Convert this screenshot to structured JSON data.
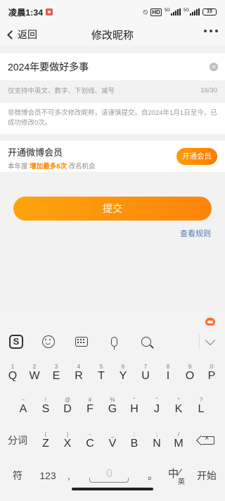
{
  "status_bar": {
    "time": "凌晨1:34",
    "hd_badge": "HD",
    "net1": "5G",
    "net2": "5G",
    "battery": "15"
  },
  "nav": {
    "back_label": "返回",
    "title": "修改昵称"
  },
  "form": {
    "nickname_value": "2024年要做好多事",
    "hint": "仅支持中英文、数字、下划线、减号",
    "char_count": "16/30",
    "notice": "非微博会员不可多次修改昵称，请谨慎提交。自2024年1月1日至今，已成功修改0次。"
  },
  "vip": {
    "title": "开通微博会员",
    "desc_prefix": "本年度",
    "desc_highlight": "增加最多8次",
    "desc_suffix": "改名机会",
    "button_label": "开通会员",
    "accent_color": "#ff8200"
  },
  "actions": {
    "submit_label": "提交",
    "rules_link": "查看规则",
    "submit_color": "#ff8f00",
    "link_color": "#507daf"
  },
  "keyboard": {
    "toolbar_icons": [
      "sogou-logo-icon",
      "emoji-icon",
      "keyboard-icon",
      "microphone-icon",
      "search-icon",
      "chevron-down-icon"
    ],
    "sogou_glyph": "S",
    "row1": [
      {
        "main": "Q",
        "sub": "1"
      },
      {
        "main": "W",
        "sub": "2"
      },
      {
        "main": "E",
        "sub": "3"
      },
      {
        "main": "R",
        "sub": "4"
      },
      {
        "main": "T",
        "sub": "5"
      },
      {
        "main": "Y",
        "sub": "6"
      },
      {
        "main": "U",
        "sub": "7"
      },
      {
        "main": "I",
        "sub": "8"
      },
      {
        "main": "O",
        "sub": "9"
      },
      {
        "main": "P",
        "sub": "0"
      }
    ],
    "row2": [
      {
        "main": "A",
        "sub": "~"
      },
      {
        "main": "S",
        "sub": "!"
      },
      {
        "main": "D",
        "sub": "@"
      },
      {
        "main": "F",
        "sub": "#"
      },
      {
        "main": "G",
        "sub": "%"
      },
      {
        "main": "H",
        "sub": "“"
      },
      {
        "main": "J",
        "sub": "”"
      },
      {
        "main": "K",
        "sub": "*"
      },
      {
        "main": "L",
        "sub": "?"
      }
    ],
    "row3": [
      {
        "main": "Z",
        "sub": "("
      },
      {
        "main": "X",
        "sub": ")"
      },
      {
        "main": "C",
        "sub": "-"
      },
      {
        "main": "V",
        "sub": "_"
      },
      {
        "main": "B",
        "sub": ":"
      },
      {
        "main": "N",
        "sub": ";"
      },
      {
        "main": "M",
        "sub": "/"
      }
    ],
    "segment_label": "分词",
    "symbol_label": "符",
    "num_label": "123",
    "comma": ",",
    "period": "。",
    "lang_zh": "中",
    "lang_en": "英",
    "enter_label": "开始"
  }
}
